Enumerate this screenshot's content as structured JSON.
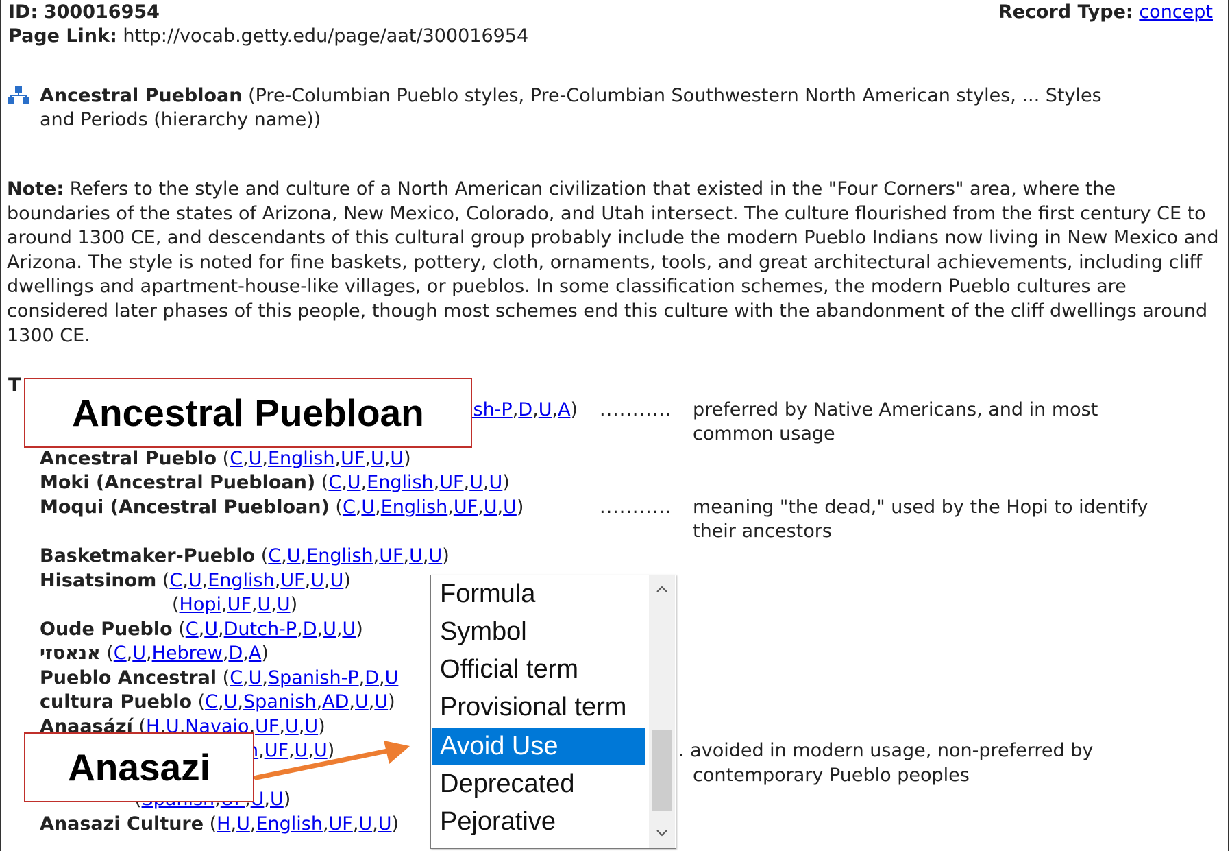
{
  "header": {
    "id_label": "ID:",
    "id_value": "300016954",
    "page_link_label": "Page Link:",
    "page_link_url": "http://vocab.getty.edu/page/aat/300016954",
    "record_type_label": "Record Type:",
    "record_type_value": "concept"
  },
  "hierarchy": {
    "term": "Ancestral Puebloan",
    "context_line1": "(Pre-Columbian Pueblo styles, Pre-Columbian Southwestern North American styles, ... Styles",
    "context_line2": "and Periods (hierarchy name))",
    "icon": "hierarchy-icon"
  },
  "note": {
    "label": "Note:",
    "text": "Refers to the style and culture of a North American civilization that existed in the \"Four Corners\" area, where the boundaries of the states of Arizona, New Mexico, Colorado, and Utah intersect. The culture flourished from the first century CE to around 1300 CE, and descendants of this cultural group probably include the modern Pueblo Indians now living in New Mexico and Arizona. The style is noted for fine baskets, pottery, cloth, ornaments, tools, and great architectural achievements, including cliff dwellings and apartment-house-like villages, or pueblos. In some classification schemes, the modern Pueblo cultures are considered later phases of this people, though most schemes end this culture with the abandonment of the cliff dwellings around 1300 CE."
  },
  "terms_label_partial": "T",
  "first_term_partial": {
    "links": [
      "ish-P",
      "D",
      "U",
      "A"
    ],
    "dots": "...........",
    "note_line1": "preferred by Native Americans, and in most",
    "note_line2": "common usage"
  },
  "terms": [
    {
      "name": "Ancestral Pueblo",
      "links": [
        "C",
        "U",
        "English",
        "UF",
        "U",
        "U"
      ]
    },
    {
      "name": "Moki (Ancestral Puebloan)",
      "links": [
        "C",
        "U",
        "English",
        "UF",
        "U",
        "U"
      ]
    },
    {
      "name": "Moqui (Ancestral Puebloan)",
      "links": [
        "C",
        "U",
        "English",
        "UF",
        "U",
        "U"
      ],
      "dots": "...........",
      "note_line1": "meaning \"the dead,\" used by the Hopi to identify",
      "note_line2": "their ancestors"
    },
    {
      "name": "Basketmaker-Pueblo",
      "links": [
        "C",
        "U",
        "English",
        "UF",
        "U",
        "U"
      ]
    },
    {
      "name": "Hisatsinom",
      "links": [
        "C",
        "U",
        "English",
        "UF",
        "U",
        "U"
      ],
      "links2": [
        "Hopi",
        "UF",
        "U",
        "U"
      ]
    },
    {
      "name": "Oude Pueblo",
      "links": [
        "C",
        "U",
        "Dutch-P",
        "D",
        "U",
        "U"
      ]
    },
    {
      "name": "אנאסזי",
      "links": [
        "C",
        "U",
        "Hebrew",
        "D",
        "A"
      ]
    },
    {
      "name": "Pueblo Ancestral",
      "links": [
        "C",
        "U",
        "Spanish-P",
        "D",
        "U"
      ]
    },
    {
      "name": "cultura Pueblo",
      "links": [
        "C",
        "U",
        "Spanish",
        "AD",
        "U",
        "U"
      ]
    },
    {
      "name": "Anaasází",
      "links": [
        "H",
        "U",
        "Navajo",
        "UF",
        "U",
        "U"
      ]
    },
    {
      "links_partial": [
        "h",
        "UF",
        "U",
        "U"
      ],
      "note_line1": ". avoided in modern usage, non-preferred by",
      "note_line2": "contemporary Pueblo peoples"
    },
    {
      "links_partial": [
        "Spanish",
        "UF",
        "U",
        "U"
      ]
    },
    {
      "name": "Anasazi Culture",
      "links": [
        "H",
        "U",
        "English",
        "UF",
        "U",
        "U"
      ]
    }
  ],
  "callouts": {
    "first": "Ancestral Puebloan",
    "second": "Anasazi"
  },
  "dropdown": {
    "options": [
      "Formula",
      "Symbol",
      "Official term",
      "Provisional term",
      "Avoid Use",
      "Deprecated",
      "Pejorative"
    ],
    "selected": "Avoid Use",
    "selected_color": "#0078d7"
  },
  "colors": {
    "link": "#0000ee",
    "callout_border": "#c0302b",
    "arrow": "#ed7d31"
  }
}
